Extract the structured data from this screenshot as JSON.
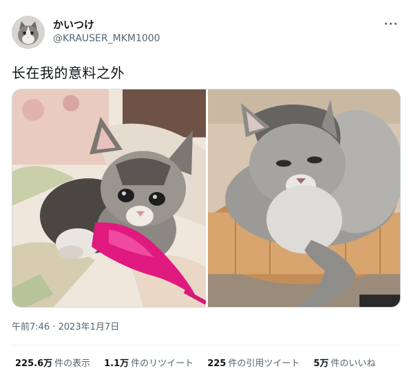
{
  "author": {
    "display_name": "かいつけ",
    "handle": "@KRAUSER_MKM1000",
    "avatar_icon": "cat-avatar-icon"
  },
  "menu_icon": "more-options-icon",
  "tweet_text": "长在我的意料之外",
  "media": {
    "left_photo": "kitten-with-pink-feather-toy",
    "right_photo": "grown-maine-coon-in-wooden-bed"
  },
  "timestamp": "午前7:46 · 2023年1月7日",
  "stats": [
    {
      "count": "225.6万",
      "label": "件の表示"
    },
    {
      "count": "1.1万",
      "label": "件のリツイート"
    },
    {
      "count": "225",
      "label": "件の引用ツイート"
    },
    {
      "count": "5万",
      "label": "件のいいね"
    }
  ],
  "colors": {
    "text_primary": "#0f1419",
    "text_secondary": "#536471",
    "border": "#cfd9de",
    "divider": "#eff3f4",
    "feather_pink": "#e0197f"
  }
}
